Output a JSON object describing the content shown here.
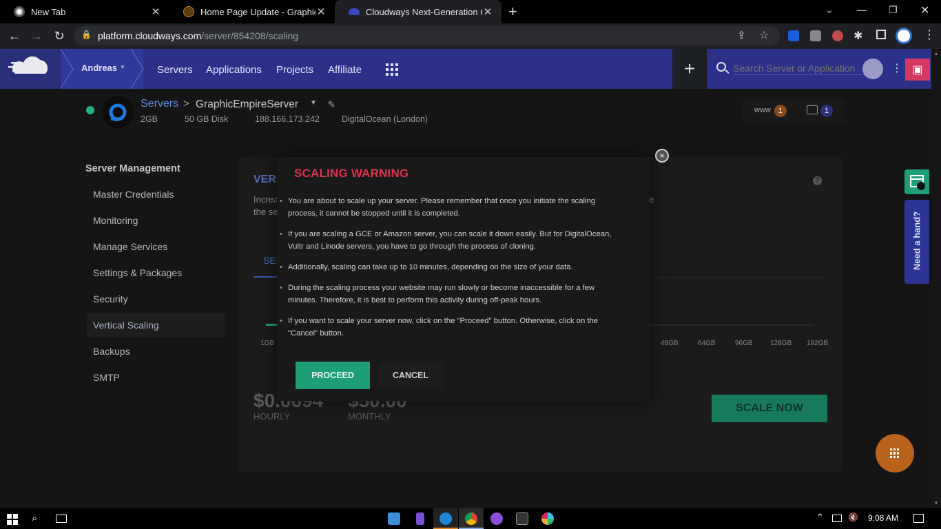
{
  "browser": {
    "tabs": [
      {
        "title": "New Tab",
        "active": false
      },
      {
        "title": "Home Page Update - Graphic Em",
        "active": false
      },
      {
        "title": "Cloudways Next-Generation Clou",
        "active": true
      }
    ],
    "new_tab_symbol": "+",
    "url_host": "platform.cloudways.com",
    "url_path": "/server/854208/scaling"
  },
  "app_nav": {
    "user_name": "Andreas",
    "links": [
      "Servers",
      "Applications",
      "Projects",
      "Affiliate"
    ],
    "search_placeholder": "Search Server or Application",
    "add_symbol": "+"
  },
  "server_header": {
    "breadcrumb_root": "Servers",
    "breadcrumb_separator": ">",
    "server_name": "GraphicEmpireServer",
    "specs": [
      "2GB",
      "50 GB Disk",
      "188.166.173.242",
      "DigitalOcean (London)"
    ],
    "www_label": "www",
    "www_count": "1",
    "folder_count": "1"
  },
  "sidebar": {
    "heading": "Server Management",
    "items": [
      {
        "label": "Master Credentials",
        "active": false
      },
      {
        "label": "Monitoring",
        "active": false
      },
      {
        "label": "Manage Services",
        "active": false
      },
      {
        "label": "Settings & Packages",
        "active": false
      },
      {
        "label": "Security",
        "active": false
      },
      {
        "label": "Vertical Scaling",
        "active": true
      },
      {
        "label": "Backups",
        "active": false
      },
      {
        "label": "SMTP",
        "active": false
      }
    ]
  },
  "scaling_card": {
    "title_partial": "VER",
    "desc_line1_partial": "Increa",
    "desc_line2_partial": "the se",
    "desc_tail": "e",
    "tab_partial": "SEI",
    "scale_ticks": [
      "1GB",
      "48GB",
      "64GB",
      "96GB",
      "128GB",
      "192GB"
    ],
    "hourly_price": "$0.0694",
    "hourly_label": "HOURLY",
    "monthly_price": "$50.00",
    "monthly_label": "MONTHLY",
    "scale_now_label": "SCALE NOW",
    "help_symbol": "?"
  },
  "modal": {
    "title": "SCALING WARNING",
    "bullets": [
      "You are about to scale up your server. Please remember that once you initiate the scaling process, it cannot be stopped until it is completed.",
      "If you are scaling a GCE or Amazon server, you can scale it down easily. But for DigitalOcean, Vultr and Linode servers, you have to go through the process of cloning.",
      "Additionally, scaling can take up to 10 minutes, depending on the size of your data.",
      "During the scaling process your website may run slowly or become inaccessible for a few minutes. Therefore, it is best to perform this activity during off-peak hours.",
      "If you want to scale your server now, click on the \"Proceed\" button. Otherwise, click on the \"Cancel\" button."
    ],
    "proceed_label": "PROCEED",
    "cancel_label": "CANCEL",
    "close_symbol": "×"
  },
  "side_widget": {
    "need_hand_label": "Need a hand?"
  },
  "taskbar": {
    "time": "9:08 AM"
  },
  "colors": {
    "brand_nav": "#2b3188",
    "warning_title": "#e0334b",
    "proceed": "#1d9e76",
    "fab": "#b8621b",
    "gift": "#d63864"
  }
}
